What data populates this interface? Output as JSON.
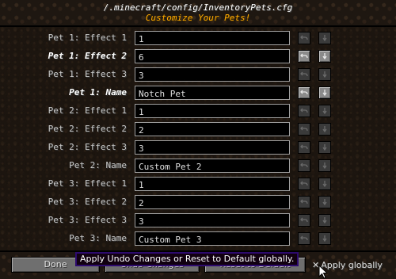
{
  "header": {
    "path": "/.minecraft/config/InventoryPets.cfg",
    "subtitle": "Customize Your Pets!"
  },
  "rows": [
    {
      "label": "Pet 1: Effect 1",
      "value": "1",
      "modified": false
    },
    {
      "label": "Pet 1: Effect 2",
      "value": "6",
      "modified": true
    },
    {
      "label": "Pet 1: Effect 3",
      "value": "3",
      "modified": false
    },
    {
      "label": "Pet 1: Name",
      "value": "Notch Pet",
      "modified": true
    },
    {
      "label": "Pet 2: Effect 1",
      "value": "1",
      "modified": false
    },
    {
      "label": "Pet 2: Effect 2",
      "value": "2",
      "modified": false
    },
    {
      "label": "Pet 2: Effect 3",
      "value": "3",
      "modified": false
    },
    {
      "label": "Pet 2: Name",
      "value": "Custom Pet 2",
      "modified": false
    },
    {
      "label": "Pet 3: Effect 1",
      "value": "1",
      "modified": false
    },
    {
      "label": "Pet 3: Effect 2",
      "value": "2",
      "modified": false
    },
    {
      "label": "Pet 3: Effect 3",
      "value": "3",
      "modified": false
    },
    {
      "label": "Pet 3: Name",
      "value": "Custom Pet 3",
      "modified": false
    }
  ],
  "row_buttons": {
    "undo_icon": "undo-arrow",
    "reset_icon": "reset-arrow"
  },
  "footer": {
    "done_label": "Done",
    "undo_label": "Undo Changes",
    "reset_label": "Reset to Default",
    "apply_checkbox": "✕",
    "apply_label": "Apply globally"
  },
  "tooltip": {
    "text": "Apply Undo Changes or Reset to Default globally."
  },
  "colors": {
    "subtitle": "#ffaa00",
    "tooltip_border": "#2d0a6e"
  }
}
